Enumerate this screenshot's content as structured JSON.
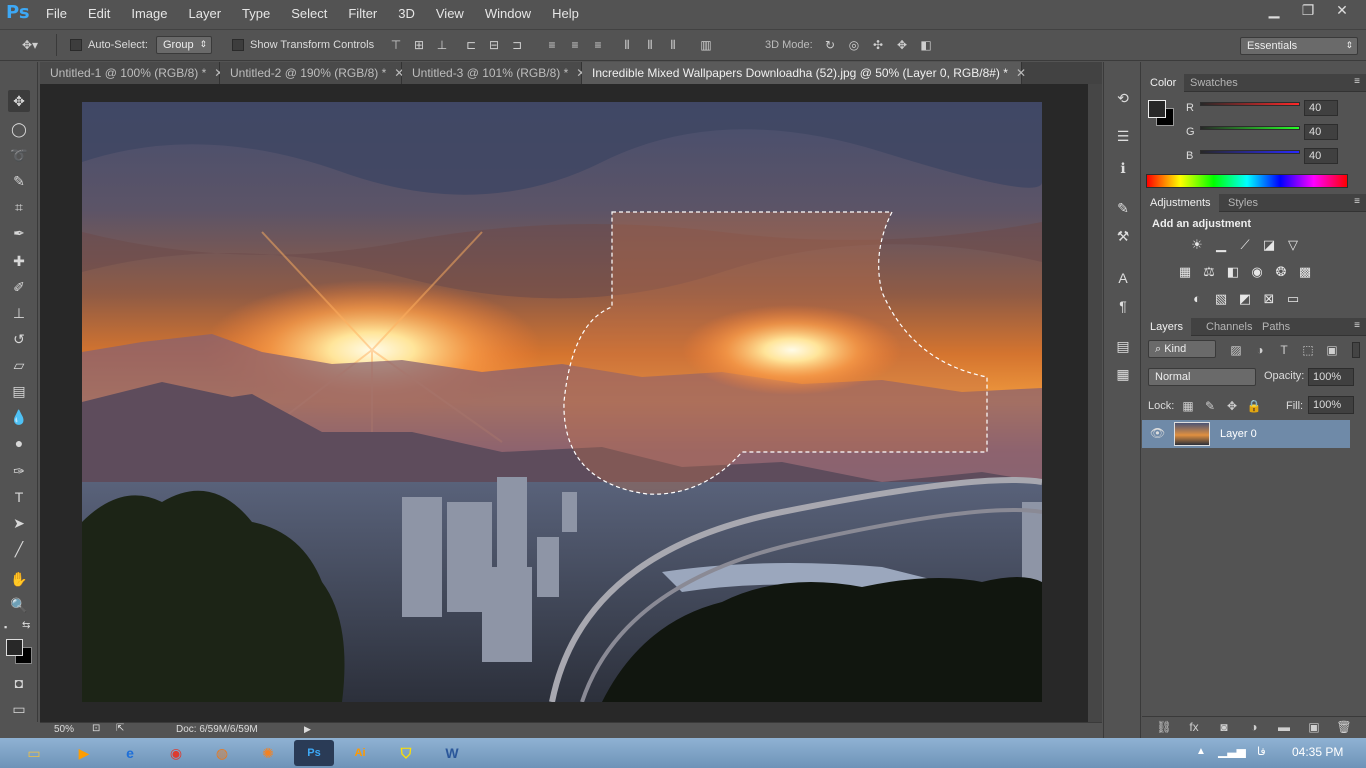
{
  "app": {
    "logo": "Ps"
  },
  "menu": [
    "File",
    "Edit",
    "Image",
    "Layer",
    "Type",
    "Select",
    "Filter",
    "3D",
    "View",
    "Window",
    "Help"
  ],
  "window_controls": {
    "minimize": "▁",
    "restore": "❐",
    "close": "✕"
  },
  "options": {
    "auto_select_label": "Auto-Select:",
    "auto_select_value": "Group",
    "show_transform_label": "Show Transform Controls",
    "mode_3d_label": "3D Mode:",
    "workspace": "Essentials"
  },
  "tabs": [
    {
      "label": "Untitled-1 @ 100% (RGB/8) *"
    },
    {
      "label": "Untitled-2 @ 190% (RGB/8) *"
    },
    {
      "label": "Untitled-3 @ 101% (RGB/8) *"
    },
    {
      "label": "Incredible Mixed Wallpapers Downloadha (52).jpg @ 50% (Layer 0, RGB/8#) *"
    }
  ],
  "status": {
    "zoom": "50%",
    "doc": "Doc: 6/59M/6/59M"
  },
  "color_panel": {
    "tabs": [
      "Color",
      "Swatches"
    ],
    "channels": [
      {
        "label": "R",
        "value": "40"
      },
      {
        "label": "G",
        "value": "40"
      },
      {
        "label": "B",
        "value": "40"
      }
    ]
  },
  "adjustments_panel": {
    "tabs": [
      "Adjustments",
      "Styles"
    ],
    "title": "Add an adjustment"
  },
  "layers_panel": {
    "tabs": [
      "Layers",
      "Channels",
      "Paths"
    ],
    "filter": "Kind",
    "blend_mode": "Normal",
    "opacity_label": "Opacity:",
    "opacity": "100%",
    "lock_label": "Lock:",
    "fill_label": "Fill:",
    "fill": "100%",
    "layers": [
      {
        "name": "Layer 0",
        "visible": true
      }
    ]
  },
  "taskbar": {
    "time": "04:35 PM",
    "lang": "فا"
  },
  "colors": {
    "accent": "#3da8f5",
    "chrome": "#535353",
    "dark": "#424242",
    "selected_layer": "#6f8aa8"
  }
}
